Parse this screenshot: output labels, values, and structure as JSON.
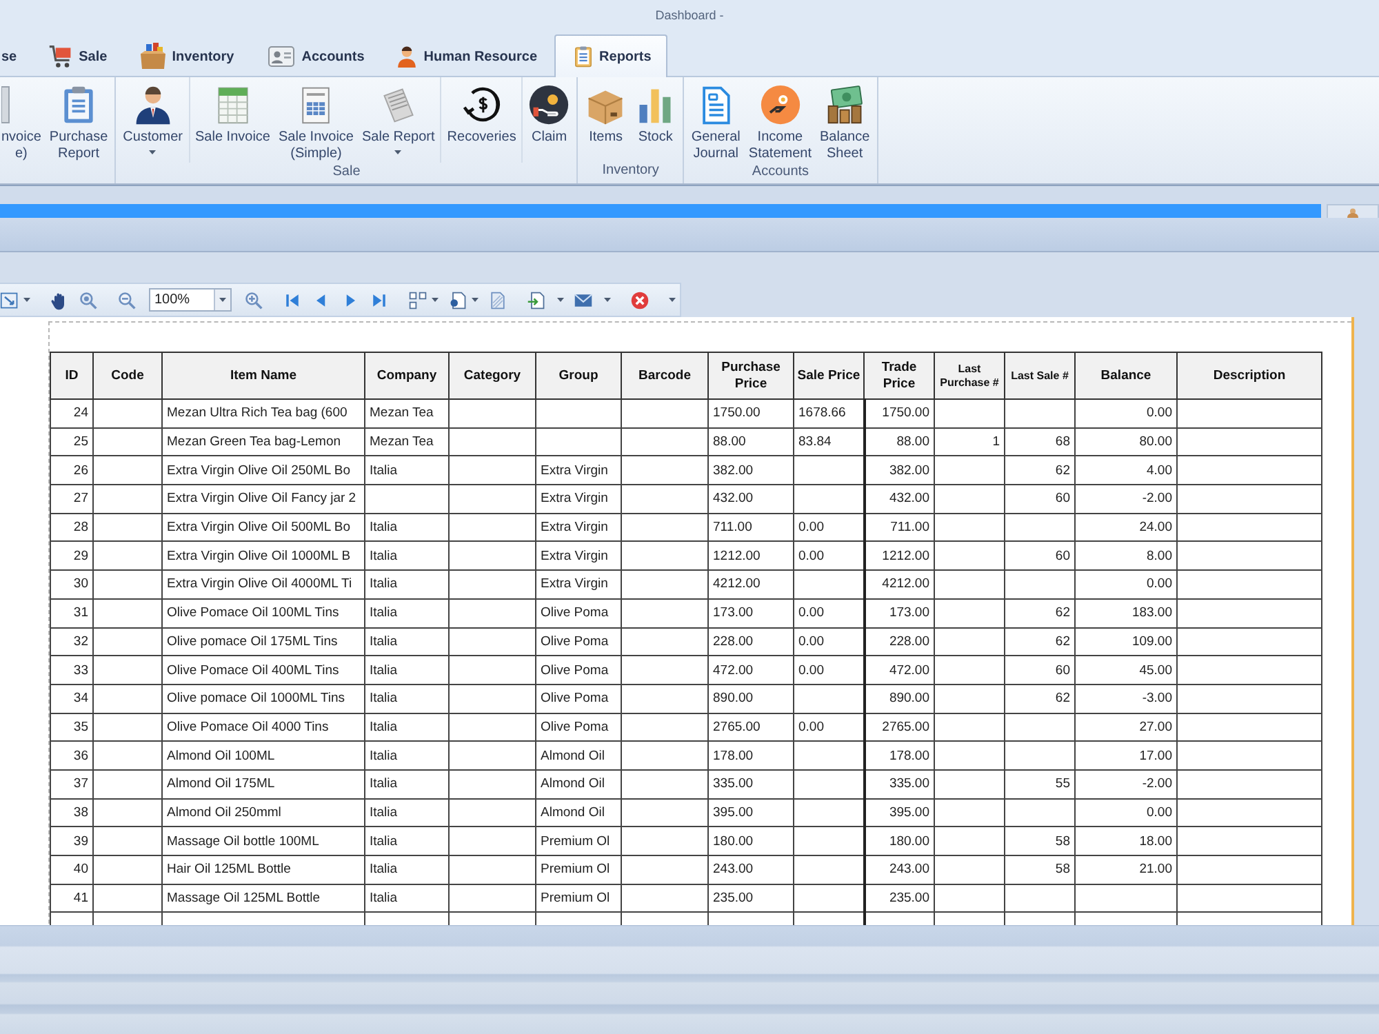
{
  "window": {
    "title": "Dashboard -"
  },
  "tabs": [
    {
      "label": "se",
      "selected": false
    },
    {
      "label": "Sale",
      "selected": false
    },
    {
      "label": "Inventory",
      "selected": false
    },
    {
      "label": "Accounts",
      "selected": false
    },
    {
      "label": "Human Resource",
      "selected": false
    },
    {
      "label": "Reports",
      "selected": true
    }
  ],
  "ribbon": {
    "groups": [
      {
        "sections": [
          {
            "items": [
              {
                "lines": [
                  "nvoice",
                  "e)"
                ],
                "has_menu": false
              },
              {
                "lines": [
                  "Purchase",
                  "Report"
                ],
                "has_menu": false
              }
            ]
          }
        ]
      },
      {
        "label": "Sale",
        "sections": [
          {
            "items": [
              {
                "lines": [
                  "Customer"
                ],
                "has_menu": true
              }
            ]
          },
          {
            "items": [
              {
                "lines": [
                  "Sale Invoice"
                ],
                "has_menu": false
              },
              {
                "lines": [
                  "Sale Invoice",
                  "(Simple)"
                ],
                "has_menu": false
              },
              {
                "lines": [
                  "Sale Report"
                ],
                "has_menu": true
              }
            ]
          },
          {
            "items": [
              {
                "lines": [
                  "Recoveries"
                ],
                "has_menu": false
              }
            ]
          },
          {
            "items": [
              {
                "lines": [
                  "Claim"
                ],
                "has_menu": false
              }
            ]
          }
        ]
      },
      {
        "label": "Inventory",
        "sections": [
          {
            "items": [
              {
                "lines": [
                  "Items"
                ],
                "has_menu": false
              },
              {
                "lines": [
                  "Stock"
                ],
                "has_menu": false
              }
            ]
          }
        ]
      },
      {
        "label": "Accounts",
        "sections": [
          {
            "items": [
              {
                "lines": [
                  "General",
                  "Journal"
                ],
                "has_menu": false
              },
              {
                "lines": [
                  "Income",
                  "Statement"
                ],
                "has_menu": false
              },
              {
                "lines": [
                  "Balance",
                  "Sheet"
                ],
                "has_menu": false
              }
            ]
          }
        ]
      }
    ]
  },
  "viewer_toolbar": {
    "zoom": {
      "value": "100%"
    }
  },
  "table": {
    "columns": [
      "ID",
      "Code",
      "Item Name",
      "Company",
      "Category",
      "Group",
      "Barcode",
      "Purchase Price",
      "Sale Price",
      "Trade Price",
      "Last Purchase #",
      "Last Sale #",
      "Balance",
      "Description"
    ],
    "rows": [
      {
        "id": "24",
        "item_name": "Mezan Ultra Rich Tea bag (600",
        "company": "Mezan Tea",
        "purchase_price": "1750.00",
        "sale_price": "1678.66",
        "trade_price": "1750.00",
        "balance": "0.00"
      },
      {
        "id": "25",
        "item_name": "Mezan Green Tea bag-Lemon",
        "company": "Mezan Tea",
        "purchase_price": "88.00",
        "sale_price": "83.84",
        "trade_price": "88.00",
        "last_purchase": "1",
        "last_sale": "68",
        "balance": "80.00"
      },
      {
        "id": "26",
        "item_name": "Extra Virgin Olive Oil 250ML Bo",
        "company": "Italia",
        "group": "Extra Virgin",
        "purchase_price": "382.00",
        "trade_price": "382.00",
        "last_sale": "62",
        "balance": "4.00"
      },
      {
        "id": "27",
        "item_name": "Extra Virgin Olive Oil Fancy jar 2",
        "group": "Extra Virgin",
        "purchase_price": "432.00",
        "trade_price": "432.00",
        "last_sale": "60",
        "balance": "-2.00"
      },
      {
        "id": "28",
        "item_name": "Extra Virgin Olive Oil 500ML Bo",
        "company": "Italia",
        "group": "Extra Virgin",
        "purchase_price": "711.00",
        "sale_price": "0.00",
        "trade_price": "711.00",
        "balance": "24.00"
      },
      {
        "id": "29",
        "item_name": "Extra Virgin Olive Oil 1000ML B",
        "company": "Italia",
        "group": "Extra Virgin",
        "purchase_price": "1212.00",
        "sale_price": "0.00",
        "trade_price": "1212.00",
        "last_sale": "60",
        "balance": "8.00"
      },
      {
        "id": "30",
        "item_name": "Extra Virgin Olive Oil 4000ML Ti",
        "company": "Italia",
        "group": "Extra Virgin",
        "purchase_price": "4212.00",
        "trade_price": "4212.00",
        "balance": "0.00"
      },
      {
        "id": "31",
        "item_name": "Olive Pomace Oil 100ML Tins",
        "company": "Italia",
        "group": "Olive Poma",
        "purchase_price": "173.00",
        "sale_price": "0.00",
        "trade_price": "173.00",
        "last_sale": "62",
        "balance": "183.00"
      },
      {
        "id": "32",
        "item_name": "Olive pomace Oil 175ML Tins",
        "company": "Italia",
        "group": "Olive Poma",
        "purchase_price": "228.00",
        "sale_price": "0.00",
        "trade_price": "228.00",
        "last_sale": "62",
        "balance": "109.00"
      },
      {
        "id": "33",
        "item_name": "Olive Pomace Oil 400ML Tins",
        "company": "Italia",
        "group": "Olive Poma",
        "purchase_price": "472.00",
        "sale_price": "0.00",
        "trade_price": "472.00",
        "last_sale": "60",
        "balance": "45.00"
      },
      {
        "id": "34",
        "item_name": "Olive pomace Oil 1000ML Tins",
        "company": "Italia",
        "group": "Olive Poma",
        "purchase_price": "890.00",
        "trade_price": "890.00",
        "last_sale": "62",
        "balance": "-3.00"
      },
      {
        "id": "35",
        "item_name": "Olive Pomace Oil 4000 Tins",
        "company": "Italia",
        "group": "Olive Poma",
        "purchase_price": "2765.00",
        "sale_price": "0.00",
        "trade_price": "2765.00",
        "balance": "27.00"
      },
      {
        "id": "36",
        "item_name": "Almond Oil 100ML",
        "company": "Italia",
        "group": "Almond Oil",
        "purchase_price": "178.00",
        "trade_price": "178.00",
        "balance": "17.00"
      },
      {
        "id": "37",
        "item_name": "Almond Oil 175ML",
        "company": "Italia",
        "group": "Almond Oil",
        "purchase_price": "335.00",
        "trade_price": "335.00",
        "last_sale": "55",
        "balance": "-2.00"
      },
      {
        "id": "38",
        "item_name": "Almond Oil 250mml",
        "company": "Italia",
        "group": "Almond Oil",
        "purchase_price": "395.00",
        "trade_price": "395.00",
        "balance": "0.00"
      },
      {
        "id": "39",
        "item_name": "Massage Oil bottle 100ML",
        "company": "Italia",
        "group": "Premium Ol",
        "purchase_price": "180.00",
        "trade_price": "180.00",
        "last_sale": "58",
        "balance": "18.00"
      },
      {
        "id": "40",
        "item_name": "Hair Oil 125ML Bottle",
        "company": "Italia",
        "group": "Premium Ol",
        "purchase_price": "243.00",
        "trade_price": "243.00",
        "last_sale": "58",
        "balance": "21.00"
      },
      {
        "id": "41",
        "item_name": "Massage Oil 125ML Bottle",
        "company": "Italia",
        "group": "Premium Ol",
        "purchase_price": "235.00",
        "trade_price": "235.00"
      }
    ]
  }
}
